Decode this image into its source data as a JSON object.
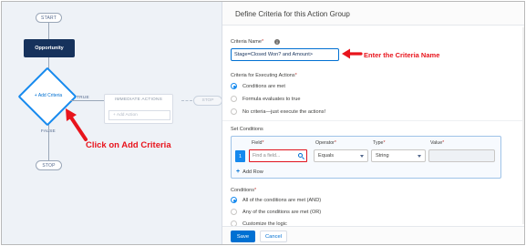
{
  "flow": {
    "start_label": "START",
    "object_label": "Opportunity",
    "criteria_node_label": "+ Add Criteria",
    "true_label": "TRUE",
    "false_label": "FALSE",
    "immediate_actions_title": "IMMEDIATE ACTIONS",
    "add_action_label": "+ Add Action",
    "stop_faint_label": "STOP",
    "stop_label": "STOP"
  },
  "annotations": {
    "click_add_criteria": "Click on Add Criteria",
    "enter_criteria_name": "Enter the Criteria Name",
    "color": "#e8141c"
  },
  "panel": {
    "title": "Define Criteria for this Action Group",
    "criteria_name_label": "Criteria Name",
    "criteria_name_value": "Stage=Closed Won? and Amount>",
    "executing_actions_label": "Criteria for Executing Actions",
    "executing_options": [
      {
        "label": "Conditions are met",
        "selected": true
      },
      {
        "label": "Formula evaluates to true",
        "selected": false
      },
      {
        "label": "No criteria—just execute the actions!",
        "selected": false
      }
    ],
    "set_conditions_label": "Set Conditions",
    "columns": {
      "field": "Field",
      "operator": "Operator",
      "type": "Type",
      "value": "Value"
    },
    "row": {
      "number": "1",
      "field_placeholder": "Find a field...",
      "operator": "Equals",
      "type": "String",
      "value": ""
    },
    "add_row_label": "Add Row",
    "conditions_label": "Conditions",
    "conditions_options": [
      {
        "label": "All of the conditions are met (AND)",
        "selected": true
      },
      {
        "label": "Any of the conditions are met (OR)",
        "selected": false
      },
      {
        "label": "Customize the logic",
        "selected": false
      }
    ],
    "save_label": "Save",
    "cancel_label": "Cancel"
  },
  "colors": {
    "brand_blue": "#0070d2",
    "node_navy": "#16325c",
    "diamond_blue": "#1589ee",
    "canvas_bg": "#eef2f7"
  }
}
